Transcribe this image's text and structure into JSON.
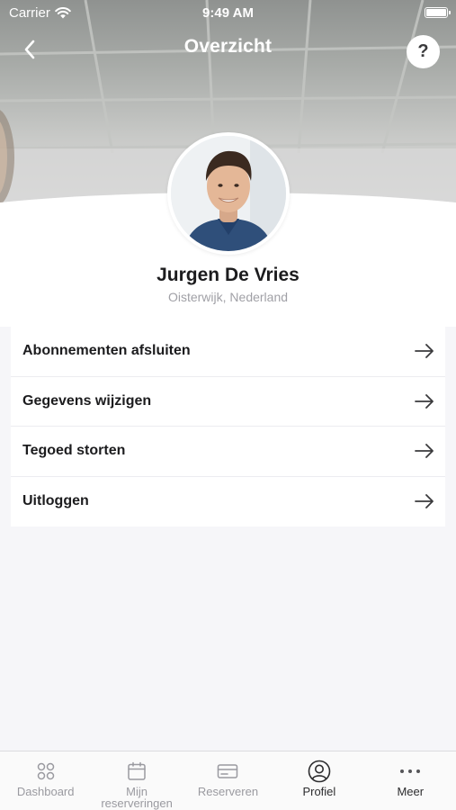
{
  "status_bar": {
    "carrier": "Carrier",
    "time": "9:49 AM"
  },
  "nav": {
    "title": "Overzicht",
    "help_label": "?"
  },
  "profile": {
    "name": "Jurgen De Vries",
    "location": "Oisterwijk, Nederland"
  },
  "menu": {
    "items": [
      {
        "label": "Abonnementen afsluiten"
      },
      {
        "label": "Gegevens wijzigen"
      },
      {
        "label": "Tegoed storten"
      },
      {
        "label": "Uitloggen"
      }
    ]
  },
  "tabbar": {
    "items": [
      {
        "label": "Dashboard",
        "icon": "four-dots-icon"
      },
      {
        "label": "Mijn reserveringen",
        "icon": "calendar-icon"
      },
      {
        "label": "Reserveren",
        "icon": "card-icon"
      },
      {
        "label": "Profiel",
        "icon": "profile-icon",
        "active": true
      },
      {
        "label": "Meer",
        "icon": "more-icon"
      }
    ]
  },
  "colors": {
    "accent": "#2c2c2e",
    "inactive": "#9a9aa0",
    "background": "#f6f6f9"
  }
}
